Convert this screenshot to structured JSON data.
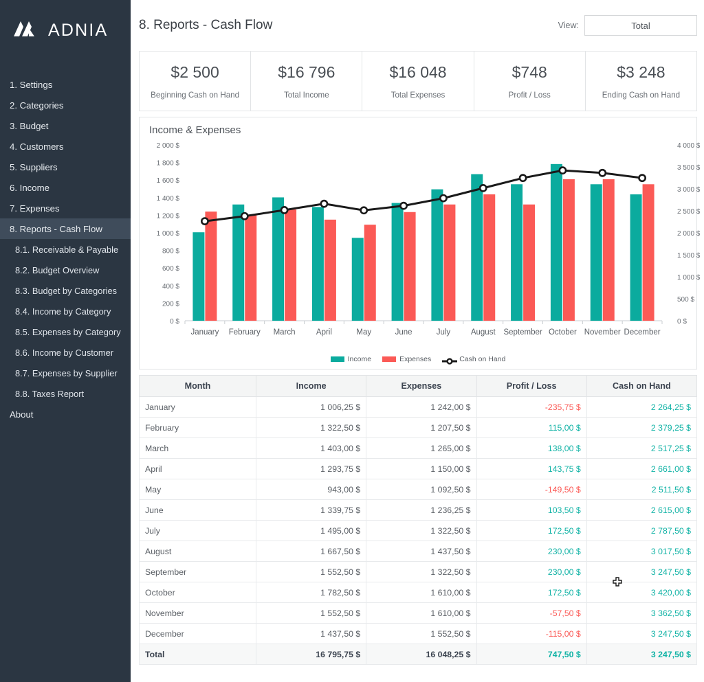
{
  "brand": {
    "name": "ADNIA",
    "logo_icon": "adnia-logo-icon"
  },
  "sidebar": {
    "items": [
      {
        "label": "1. Settings",
        "level": 0,
        "active": false
      },
      {
        "label": "2. Categories",
        "level": 0,
        "active": false
      },
      {
        "label": "3. Budget",
        "level": 0,
        "active": false
      },
      {
        "label": "4. Customers",
        "level": 0,
        "active": false
      },
      {
        "label": "5. Suppliers",
        "level": 0,
        "active": false
      },
      {
        "label": "6. Income",
        "level": 0,
        "active": false
      },
      {
        "label": "7. Expenses",
        "level": 0,
        "active": false
      },
      {
        "label": "8. Reports - Cash Flow",
        "level": 0,
        "active": true
      },
      {
        "label": "8.1. Receivable & Payable",
        "level": 1,
        "active": false
      },
      {
        "label": "8.2. Budget Overview",
        "level": 1,
        "active": false
      },
      {
        "label": "8.3. Budget by Categories",
        "level": 1,
        "active": false
      },
      {
        "label": "8.4. Income by Category",
        "level": 1,
        "active": false
      },
      {
        "label": "8.5. Expenses by Category",
        "level": 1,
        "active": false
      },
      {
        "label": "8.6. Income by Customer",
        "level": 1,
        "active": false
      },
      {
        "label": "8.7. Expenses by Supplier",
        "level": 1,
        "active": false
      },
      {
        "label": "8.8. Taxes Report",
        "level": 1,
        "active": false
      },
      {
        "label": "About",
        "level": 0,
        "active": false
      }
    ]
  },
  "header": {
    "title": "8. Reports - Cash Flow",
    "view_label": "View:",
    "view_value": "Total"
  },
  "kpis": [
    {
      "value": "$2 500",
      "label": "Beginning Cash on Hand"
    },
    {
      "value": "$16 796",
      "label": "Total Income"
    },
    {
      "value": "$16 048",
      "label": "Total Expenses"
    },
    {
      "value": "$748",
      "label": "Profit / Loss"
    },
    {
      "value": "$3 248",
      "label": "Ending Cash on Hand"
    }
  ],
  "colors": {
    "income": "#0bab9e",
    "expenses": "#fb5a56",
    "cash_on_hand": "#1a1a1a",
    "sidebar_bg": "#2b3642",
    "sidebar_active": "#3f4c5b",
    "positive": "#12b3a6",
    "negative": "#fb5a56"
  },
  "chart_data": {
    "type": "bar",
    "title": "Income & Expenses",
    "xlabel": "",
    "ylabel": "",
    "grid": false,
    "legend_position": "bottom",
    "categories": [
      "January",
      "February",
      "March",
      "April",
      "May",
      "June",
      "July",
      "August",
      "September",
      "October",
      "November",
      "December"
    ],
    "series": [
      {
        "name": "Income",
        "type": "bar",
        "axis": "left",
        "color": "#0bab9e",
        "values": [
          1006.25,
          1322.5,
          1403.0,
          1293.75,
          943.0,
          1339.75,
          1495.0,
          1667.5,
          1552.5,
          1782.5,
          1552.5,
          1437.5
        ]
      },
      {
        "name": "Expenses",
        "type": "bar",
        "axis": "left",
        "color": "#fb5a56",
        "values": [
          1242.0,
          1207.5,
          1265.0,
          1150.0,
          1092.5,
          1236.25,
          1322.5,
          1437.5,
          1322.5,
          1610.0,
          1610.0,
          1552.5
        ]
      },
      {
        "name": "Cash on Hand",
        "type": "line",
        "axis": "right",
        "color": "#1a1a1a",
        "values": [
          2264.25,
          2379.25,
          2517.25,
          2661.0,
          2511.5,
          2615.0,
          2787.5,
          3017.5,
          3247.5,
          3420.0,
          3362.5,
          3247.5
        ]
      }
    ],
    "ylim": [
      0,
      2000
    ],
    "y_ticks": [
      "0 $",
      "200 $",
      "400 $",
      "600 $",
      "800 $",
      "1 000 $",
      "1 200 $",
      "1 400 $",
      "1 600 $",
      "1 800 $",
      "2 000 $"
    ],
    "y2lim": [
      0,
      4000
    ],
    "y2_ticks": [
      "0 $",
      "500 $",
      "1 000 $",
      "1 500 $",
      "2 000 $",
      "2 500 $",
      "3 000 $",
      "3 500 $",
      "4 000 $"
    ]
  },
  "table": {
    "columns": [
      "Month",
      "Income",
      "Expenses",
      "Profit / Loss",
      "Cash on Hand"
    ],
    "rows": [
      {
        "month": "January",
        "income": "1 006,25 $",
        "expenses": "1 242,00 $",
        "profit": "-235,75 $",
        "profit_sign": "neg",
        "cash": "2 264,25 $"
      },
      {
        "month": "February",
        "income": "1 322,50 $",
        "expenses": "1 207,50 $",
        "profit": "115,00 $",
        "profit_sign": "pos",
        "cash": "2 379,25 $"
      },
      {
        "month": "March",
        "income": "1 403,00 $",
        "expenses": "1 265,00 $",
        "profit": "138,00 $",
        "profit_sign": "pos",
        "cash": "2 517,25 $"
      },
      {
        "month": "April",
        "income": "1 293,75 $",
        "expenses": "1 150,00 $",
        "profit": "143,75 $",
        "profit_sign": "pos",
        "cash": "2 661,00 $"
      },
      {
        "month": "May",
        "income": "943,00 $",
        "expenses": "1 092,50 $",
        "profit": "-149,50 $",
        "profit_sign": "neg",
        "cash": "2 511,50 $"
      },
      {
        "month": "June",
        "income": "1 339,75 $",
        "expenses": "1 236,25 $",
        "profit": "103,50 $",
        "profit_sign": "pos",
        "cash": "2 615,00 $"
      },
      {
        "month": "July",
        "income": "1 495,00 $",
        "expenses": "1 322,50 $",
        "profit": "172,50 $",
        "profit_sign": "pos",
        "cash": "2 787,50 $"
      },
      {
        "month": "August",
        "income": "1 667,50 $",
        "expenses": "1 437,50 $",
        "profit": "230,00 $",
        "profit_sign": "pos",
        "cash": "3 017,50 $"
      },
      {
        "month": "September",
        "income": "1 552,50 $",
        "expenses": "1 322,50 $",
        "profit": "230,00 $",
        "profit_sign": "pos",
        "cash": "3 247,50 $"
      },
      {
        "month": "October",
        "income": "1 782,50 $",
        "expenses": "1 610,00 $",
        "profit": "172,50 $",
        "profit_sign": "pos",
        "cash": "3 420,00 $"
      },
      {
        "month": "November",
        "income": "1 552,50 $",
        "expenses": "1 610,00 $",
        "profit": "-57,50 $",
        "profit_sign": "neg",
        "cash": "3 362,50 $"
      },
      {
        "month": "December",
        "income": "1 437,50 $",
        "expenses": "1 552,50 $",
        "profit": "-115,00 $",
        "profit_sign": "neg",
        "cash": "3 247,50 $"
      }
    ],
    "total": {
      "month": "Total",
      "income": "16 795,75 $",
      "expenses": "16 048,25 $",
      "profit": "747,50 $",
      "profit_sign": "pos",
      "cash": "3 247,50 $"
    }
  }
}
